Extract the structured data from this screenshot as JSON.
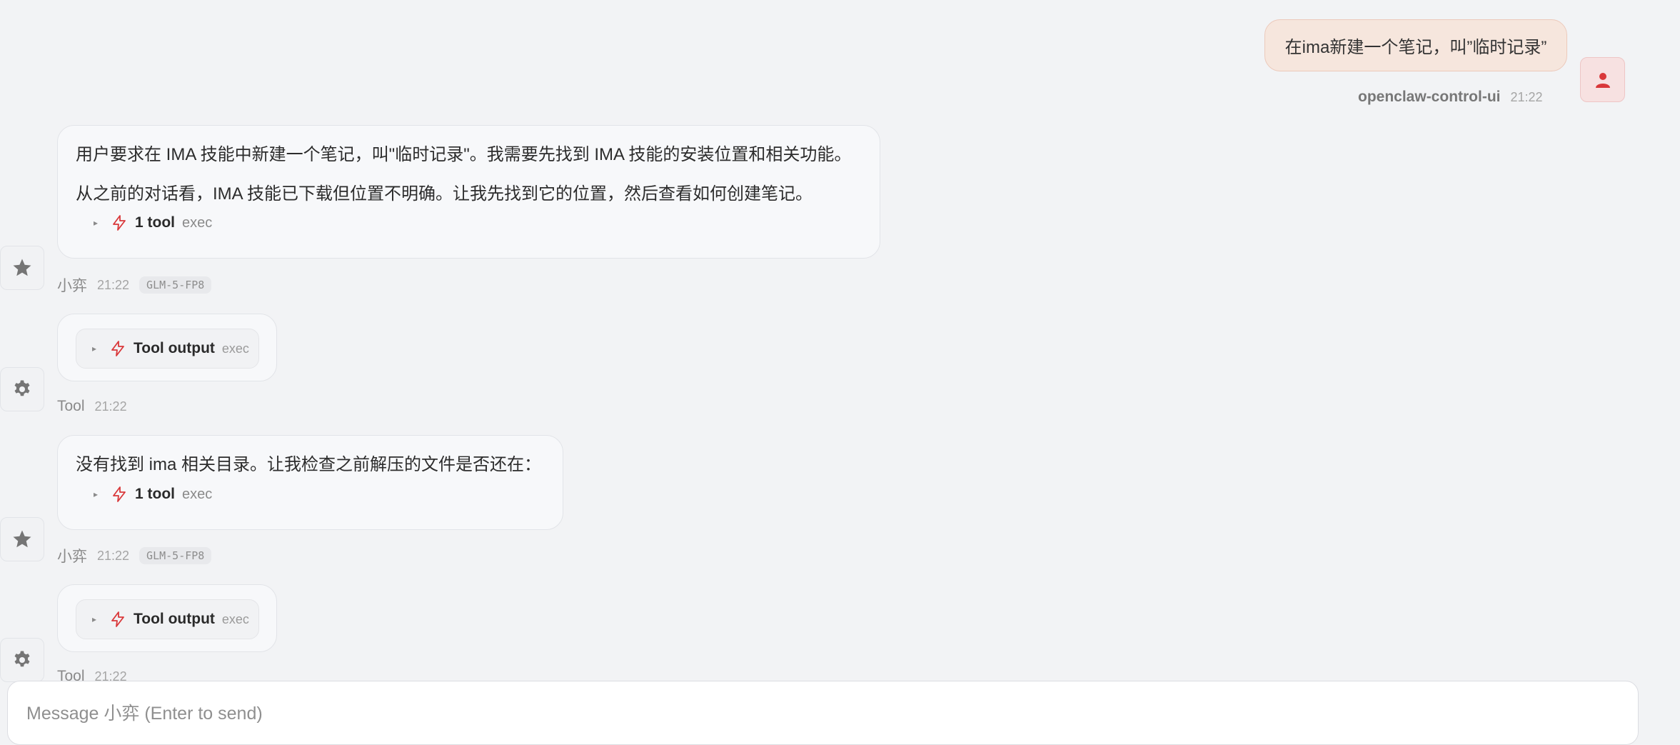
{
  "user_message": {
    "text": "在ima新建一个笔记，叫”临时记录”",
    "sender": "openclaw-control-ui",
    "time": "21:22",
    "avatar_icon": "person-icon"
  },
  "messages": [
    {
      "role": "assistant",
      "paragraphs": [
        "用户要求在 IMA 技能中新建一个笔记，叫\"临时记录\"。我需要先找到 IMA 技能的安装位置和相关功能。",
        "从之前的对话看，IMA 技能已下载但位置不明确。让我先找到它的位置，然后查看如何创建笔记。"
      ],
      "tool": {
        "name": "1 tool",
        "kind": "exec"
      },
      "meta": {
        "sender": "小弈",
        "time": "21:22",
        "model": "GLM-5-FP8"
      },
      "avatar_icon": "star-icon"
    },
    {
      "role": "tool",
      "tool": {
        "name": "Tool output",
        "kind": "exec"
      },
      "meta": {
        "sender": "Tool",
        "time": "21:22"
      },
      "avatar_icon": "gear-icon"
    },
    {
      "role": "assistant",
      "paragraphs": [
        "没有找到 ima 相关目录。让我检查之前解压的文件是否还在："
      ],
      "tool": {
        "name": "1 tool",
        "kind": "exec"
      },
      "meta": {
        "sender": "小弈",
        "time": "21:22",
        "model": "GLM-5-FP8"
      },
      "avatar_icon": "star-icon"
    },
    {
      "role": "tool",
      "tool": {
        "name": "Tool output",
        "kind": "exec"
      },
      "meta": {
        "sender": "Tool",
        "time": "21:22"
      },
      "avatar_icon": "gear-icon"
    }
  ],
  "composer": {
    "placeholder": "Message 小弈 (Enter to send)",
    "value": ""
  },
  "colors": {
    "accent": "#d9383a",
    "user_bubble": "#f6e6dd",
    "assistant_bubble": "#f7f8fa",
    "background": "#f2f3f5"
  }
}
